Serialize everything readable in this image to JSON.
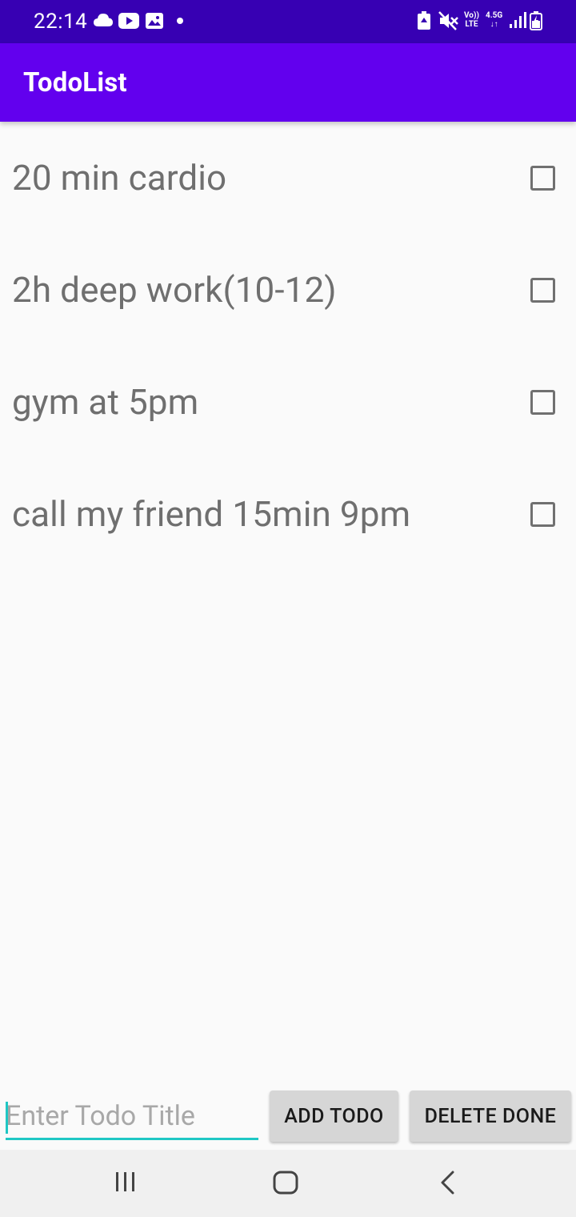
{
  "status_bar": {
    "time": "22:14",
    "icons_left": [
      "cloud-icon",
      "youtube-icon",
      "gallery-icon",
      "notification-dot"
    ],
    "icons_right": [
      "battery-saver-icon",
      "mute-icon",
      "volte-icon",
      "network-4-5g-icon",
      "signal-icon",
      "battery-icon"
    ],
    "volte_top": "Vo))",
    "volte_bottom": "LTE",
    "network_top": "4.5G",
    "network_bottom": "↓↑"
  },
  "app_bar": {
    "title": "TodoList"
  },
  "todos": [
    {
      "title": "20 min cardio",
      "done": false
    },
    {
      "title": "2h deep work(10-12)",
      "done": false
    },
    {
      "title": "gym at 5pm",
      "done": false
    },
    {
      "title": "call my friend 15min 9pm",
      "done": false
    }
  ],
  "input_row": {
    "placeholder": "Enter Todo Title",
    "value": "",
    "add_label": "ADD TODO",
    "delete_label": "DELETE DONE"
  },
  "nav_bar": {
    "icons": [
      "recents-icon",
      "home-icon",
      "back-icon"
    ]
  },
  "colors": {
    "status_bar": "#3700b3",
    "app_bar": "#6200ee",
    "background": "#fafafa",
    "accent": "#1fc7c4",
    "button": "#d6d6d6"
  }
}
